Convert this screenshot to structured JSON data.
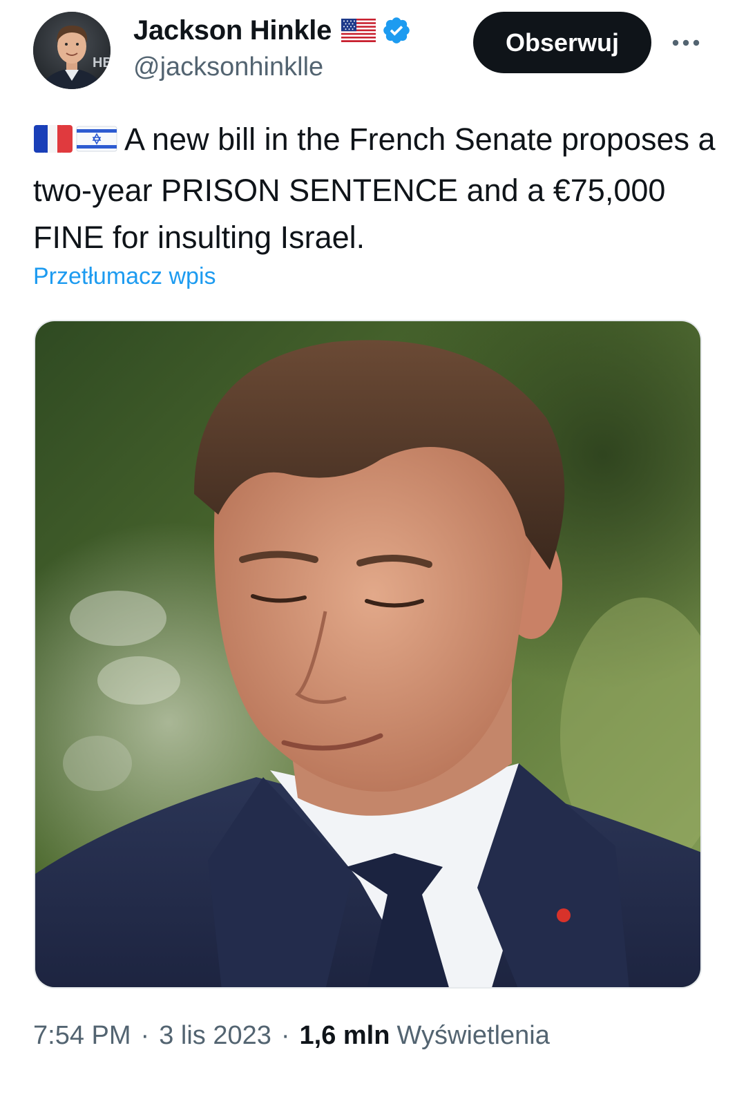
{
  "author": {
    "display_name": "Jackson Hinkle",
    "handle": "@jacksonhinklle",
    "avatar_badge_text": "HB",
    "flag_icon": "us-flag-icon",
    "verified_icon": "verified-badge-icon"
  },
  "follow_button": {
    "label": "Obserwuj"
  },
  "more_button": {
    "label": "•••"
  },
  "tweet": {
    "flags": [
      "france-flag-icon",
      "israel-flag-icon"
    ],
    "text": "A new bill in the French Senate proposes a two-year PRISON SENTENCE and a €75,000 FINE for insulting Israel.",
    "translate_link": "Przetłumacz wpis"
  },
  "media": {
    "description_icon": "photo-of-man-in-suit"
  },
  "meta": {
    "time": "7:54 PM",
    "separator": "·",
    "date": "3 lis 2023",
    "views_count": "1,6 mln",
    "views_label": "Wyświetlenia"
  },
  "colors": {
    "text_primary": "#0f1419",
    "text_secondary": "#536471",
    "link": "#1d9bf0",
    "verified": "#1d9bf0",
    "button_bg": "#0f1419"
  }
}
